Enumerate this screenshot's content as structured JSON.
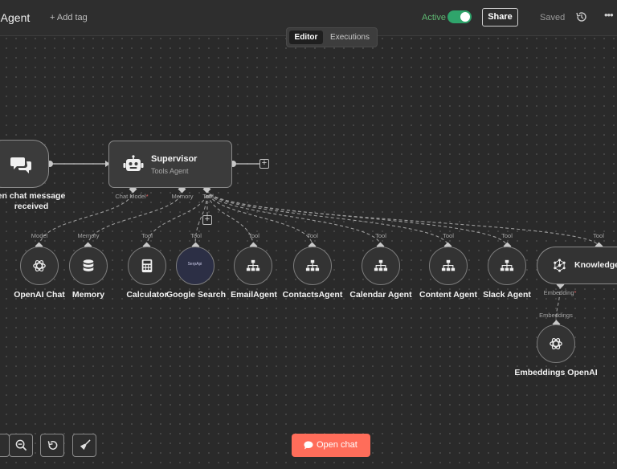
{
  "header": {
    "workflow_name": "-Agent",
    "add_tag": "+ Add tag",
    "active_label": "Active",
    "share": "Share",
    "saved": "Saved",
    "more": "•••"
  },
  "tabs": {
    "editor": "Editor",
    "executions": "Executions"
  },
  "nodes": {
    "trigger": {
      "label": "en chat message received"
    },
    "supervisor": {
      "title": "Supervisor",
      "subtitle": "Tools Agent"
    },
    "supervisor_ports": {
      "chat_model": "Chat Model",
      "memory": "Memory",
      "tool": "Tool"
    },
    "tools": [
      {
        "label": "OpenAI Chat",
        "port": "Model",
        "icon": "openai-icon"
      },
      {
        "label": "Memory",
        "port": "Memory",
        "icon": "database-icon"
      },
      {
        "label": "Calculator",
        "port": "Tool",
        "icon": "calculator-icon"
      },
      {
        "label": "Google Search",
        "port": "Tool",
        "icon": "serpapi-icon",
        "icon_text": "SerpApi"
      },
      {
        "label": "EmailAgent",
        "port": "Tool",
        "icon": "sitemap-icon"
      },
      {
        "label": "ContactsAgent",
        "port": "Tool",
        "icon": "sitemap-icon"
      },
      {
        "label": "Calendar Agent",
        "port": "Tool",
        "icon": "sitemap-icon"
      },
      {
        "label": "Content Agent",
        "port": "Tool",
        "icon": "sitemap-icon"
      },
      {
        "label": "Slack Agent",
        "port": "Tool",
        "icon": "sitemap-icon"
      }
    ],
    "knowledge": {
      "label": "Knowledge",
      "port_top": "Tool",
      "port_bottom": "Embedding"
    },
    "embeddings": {
      "label": "Embeddings OpenAI",
      "port": "Embeddings"
    }
  },
  "bottom": {
    "open_chat": "Open chat"
  },
  "colors": {
    "accent": "#ff6d5a",
    "active": "#2fa46b",
    "background": "#2a2a2a"
  }
}
